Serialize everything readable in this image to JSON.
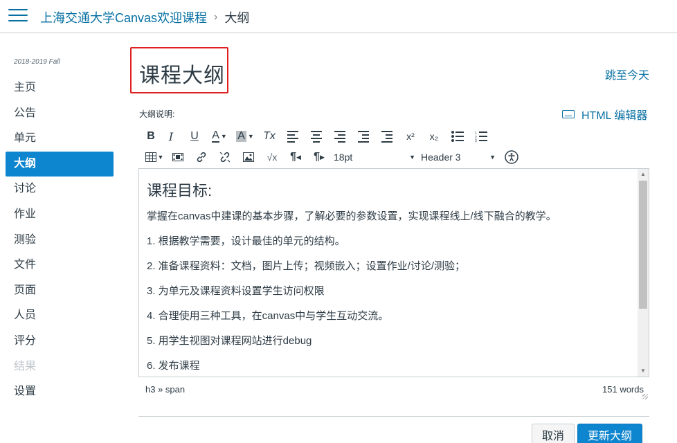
{
  "header": {
    "course": "上海交通大学Canvas欢迎课程",
    "separator": "›",
    "current": "大纲"
  },
  "sidebar": {
    "term": "2018-2019 Fall",
    "items": [
      {
        "label": "主页"
      },
      {
        "label": "公告"
      },
      {
        "label": "单元"
      },
      {
        "label": "大纲"
      },
      {
        "label": "讨论"
      },
      {
        "label": "作业"
      },
      {
        "label": "测验"
      },
      {
        "label": "文件"
      },
      {
        "label": "页面"
      },
      {
        "label": "人员"
      },
      {
        "label": "评分"
      },
      {
        "label": "结果"
      },
      {
        "label": "设置"
      }
    ]
  },
  "main": {
    "title": "课程大纲",
    "jump_today": "跳至今天",
    "description_label": "大纲说明:",
    "html_editor": "HTML 编辑器"
  },
  "toolbar": {
    "bold": "B",
    "italic": "I",
    "underline": "U",
    "text_color": "A",
    "bg_color": "A",
    "clear_format": "Tx",
    "superscript": "x²",
    "subscript": "x₂",
    "font_size": "18pt",
    "block_format": "Header 3",
    "math": "√x",
    "ltr": "¶",
    "rtl": "¶"
  },
  "editor": {
    "heading": "课程目标:",
    "paragraphs": [
      "掌握在canvas中建课的基本步骤，了解必要的参数设置，实现课程线上/线下融合的教学。",
      "1. 根据教学需要，设计最佳的单元的结构。",
      "2. 准备课程资料：文档，图片上传；视频嵌入；设置作业/讨论/测验；",
      "3. 为单元及课程资料设置学生访问权限",
      "4. 合理使用三种工具，在canvas中与学生互动交流。",
      "5. 用学生视图对课程网站进行debug",
      "6. 发布课程"
    ],
    "path": "h3 » span",
    "word_count": "151 words"
  },
  "buttons": {
    "cancel": "取消",
    "update": "更新大纲"
  }
}
